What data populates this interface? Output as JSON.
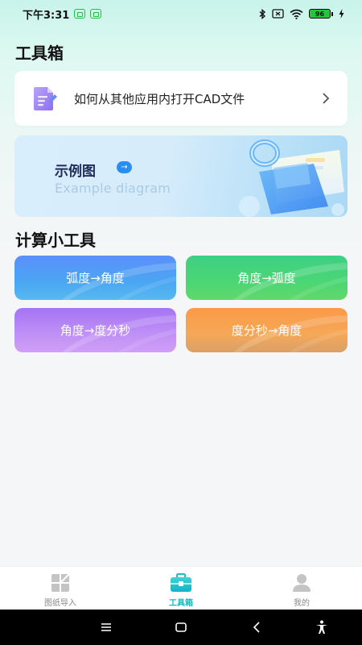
{
  "status_bar": {
    "time": "下午3:31",
    "battery": "96"
  },
  "page": {
    "title": "工具箱"
  },
  "help_card": {
    "text": "如何从其他应用内打开CAD文件",
    "icon": "document-edit-icon"
  },
  "example_banner": {
    "title": "示例图",
    "subtitle": "Example diagram",
    "arrow": "→"
  },
  "calc_section": {
    "title": "计算小工具",
    "tools": [
      {
        "label": "弧度→角度",
        "color": "#5b8ffb"
      },
      {
        "label": "角度→弧度",
        "color": "#3ecf83"
      },
      {
        "label": "角度→度分秒",
        "color": "#a574f4"
      },
      {
        "label": "度分秒→角度",
        "color": "#fb9a48"
      }
    ]
  },
  "tab_bar": {
    "active_color": "#14b8c4",
    "tabs": [
      {
        "label": "图纸导入",
        "icon": "drawing-import-icon"
      },
      {
        "label": "工具箱",
        "icon": "toolbox-icon"
      },
      {
        "label": "我的",
        "icon": "user-icon"
      }
    ]
  },
  "nav_bar": {
    "icons": [
      "menu-icon",
      "home-icon",
      "back-icon",
      "accessibility-icon"
    ]
  }
}
